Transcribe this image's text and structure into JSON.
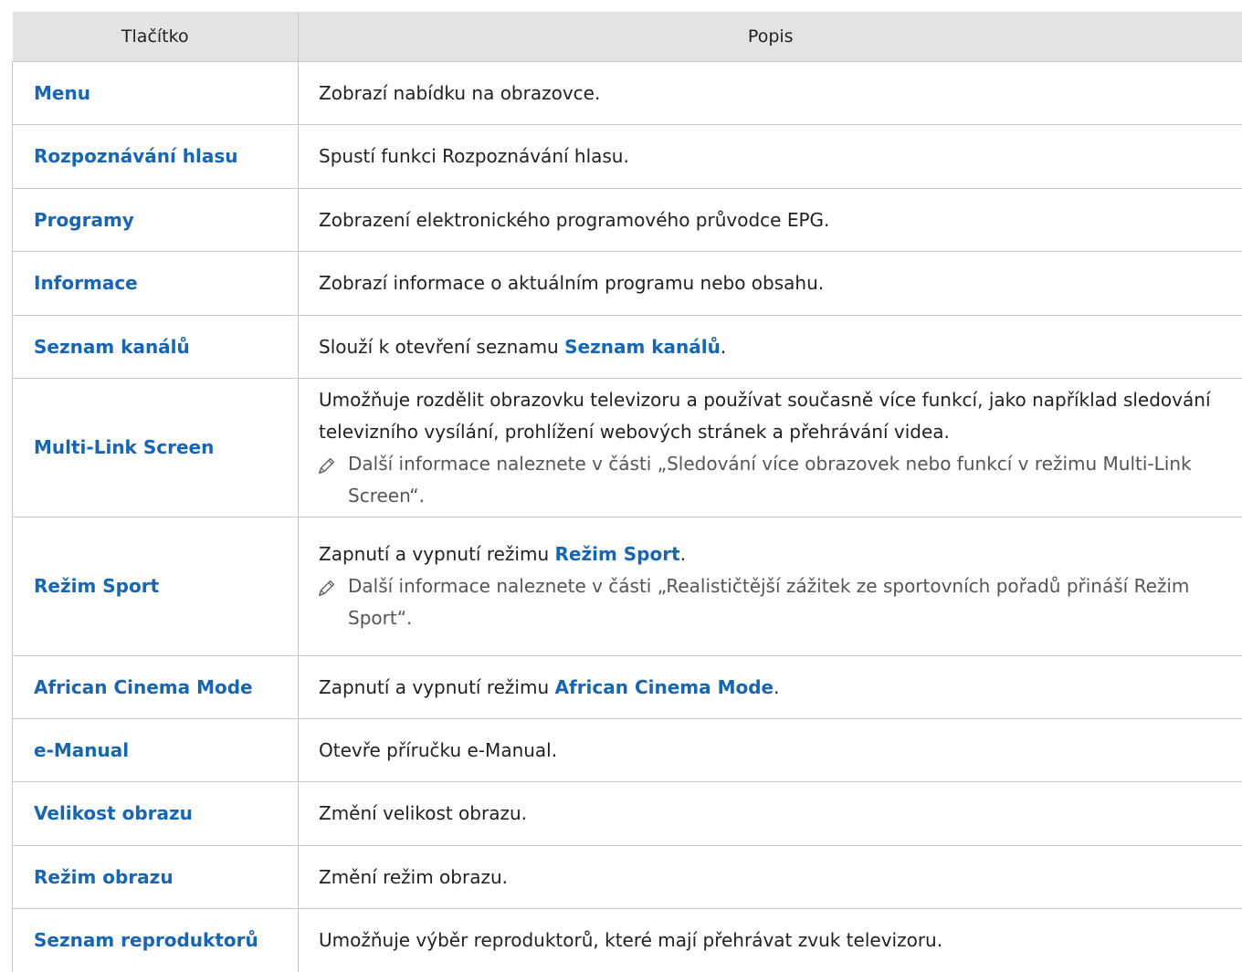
{
  "table": {
    "headers": [
      "Tlačítko",
      "Popis"
    ],
    "rows": [
      {
        "key": "Menu",
        "pre": "Zobrazí nabídku na obrazovce.",
        "hl": "",
        "post": "",
        "note": ""
      },
      {
        "key": "Rozpoznávání hlasu",
        "pre": "Spustí funkci Rozpoznávání hlasu.",
        "hl": "",
        "post": "",
        "note": ""
      },
      {
        "key": "Programy",
        "pre": "Zobrazení elektronického programového průvodce EPG.",
        "hl": "",
        "post": "",
        "note": ""
      },
      {
        "key": "Informace",
        "pre": "Zobrazí informace o aktuálním programu nebo obsahu.",
        "hl": "",
        "post": "",
        "note": ""
      },
      {
        "key": "Seznam kanálů",
        "pre": "Slouží k otevření seznamu ",
        "hl": "Seznam kanálů",
        "post": ".",
        "note": ""
      },
      {
        "key": "Multi-Link Screen",
        "pre": "Umožňuje rozdělit obrazovku televizoru a používat současně více funkcí, jako například sledování televizního vysílání, prohlížení webových stránek a přehrávání videa.",
        "hl": "",
        "post": "",
        "note": "Další informace naleznete v části „Sledování více obrazovek nebo funkcí v režimu Multi-Link Screen“."
      },
      {
        "key": "Režim Sport",
        "pre": "Zapnutí a vypnutí režimu ",
        "hl": "Režim Sport",
        "post": ".",
        "note": "Další informace naleznete v části „Realističtější zážitek ze sportovních pořadů přináší Režim Sport“."
      },
      {
        "key": "African Cinema Mode",
        "pre": "Zapnutí a vypnutí režimu ",
        "hl": "African Cinema Mode",
        "post": ".",
        "note": ""
      },
      {
        "key": "e-Manual",
        "pre": "Otevře příručku e-Manual.",
        "hl": "",
        "post": "",
        "note": ""
      },
      {
        "key": "Velikost obrazu",
        "pre": "Změní velikost obrazu.",
        "hl": "",
        "post": "",
        "note": ""
      },
      {
        "key": "Režim obrazu",
        "pre": "Změní režim obrazu.",
        "hl": "",
        "post": "",
        "note": ""
      },
      {
        "key": "Seznam reproduktorů",
        "pre": "Umožňuje výběr reproduktorů, které mají přehrávat zvuk televizoru.",
        "hl": "",
        "post": "",
        "note": ""
      }
    ]
  },
  "icons": {
    "note": "pencil-icon"
  },
  "colors": {
    "link": "#1565b8",
    "header_bg": "#e3e3e3",
    "border": "#c8c8c8",
    "note_text": "#555555"
  }
}
